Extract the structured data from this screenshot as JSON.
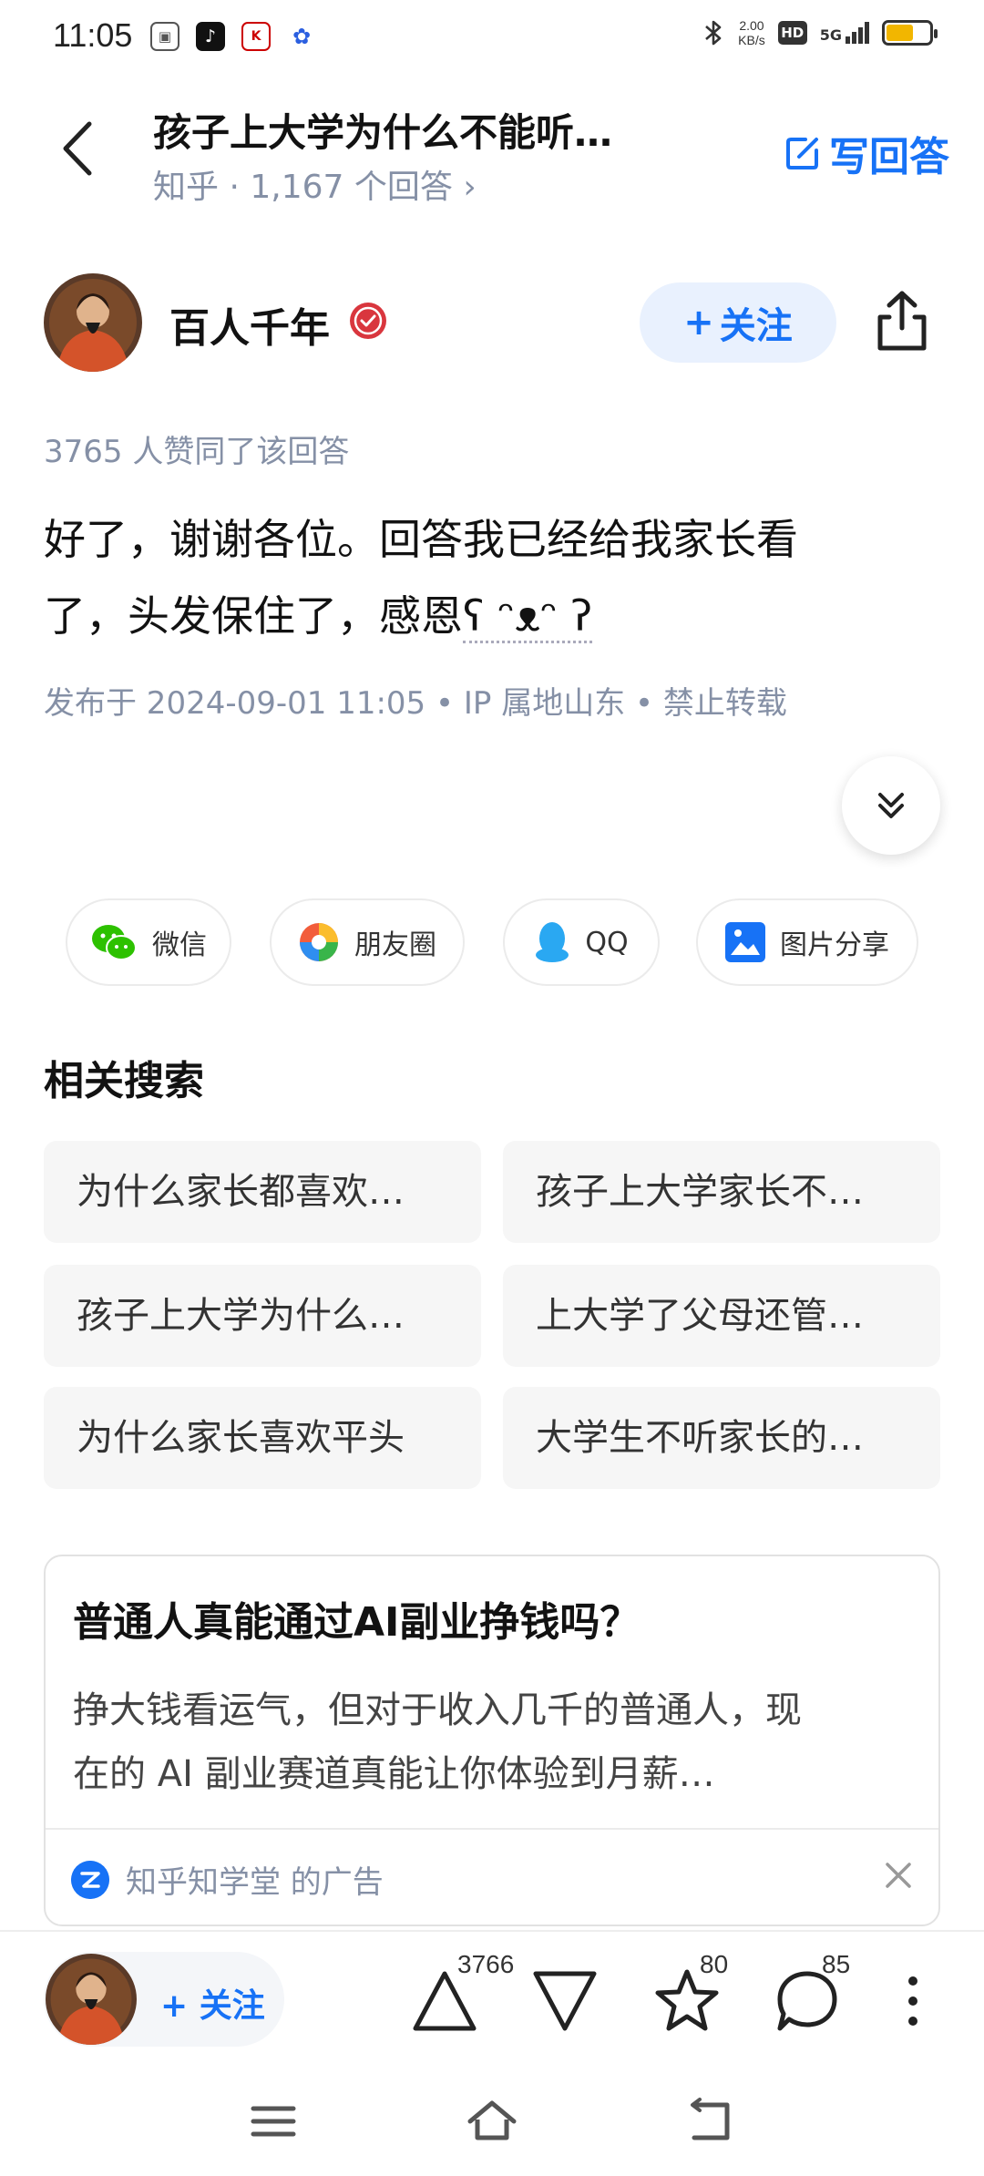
{
  "status_bar": {
    "time": "11:05",
    "net_speed_value": "2.00",
    "net_speed_unit": "KB/s",
    "hd": "HD",
    "signal": "5G"
  },
  "header": {
    "question_title": "孩子上大学为什么不能听…",
    "source": "知乎",
    "answer_count": "1,167 个回答",
    "write_answer": "写回答"
  },
  "author": {
    "name": "百人千年",
    "follow_label": "关注"
  },
  "answer": {
    "agree_text": "3765 人赞同了该回答",
    "line1": "好了，谢谢各位。回答我已经给我家长看",
    "line2_text": "了，头发保住了，感恩",
    "line2_kaomoji": "ʕ ᵔᴥᵔ ʔ",
    "publish_date": "发布于 2024-09-01 11:05",
    "ip": "IP 属地山东",
    "copyright": "禁止转载"
  },
  "share": {
    "items": [
      {
        "label": "微信"
      },
      {
        "label": "朋友圈"
      },
      {
        "label": "QQ"
      },
      {
        "label": "图片分享"
      }
    ]
  },
  "related": {
    "title": "相关搜索",
    "items": [
      {
        "label": "为什么家长都喜欢…"
      },
      {
        "label": "孩子上大学家长不…"
      },
      {
        "label": "孩子上大学为什么…"
      },
      {
        "label": "上大学了父母还管…"
      },
      {
        "label": "为什么家长喜欢平头"
      },
      {
        "label": "大学生不听家长的…"
      }
    ]
  },
  "ad": {
    "title": "普通人真能通过AI副业挣钱吗？",
    "desc_line1": "挣大钱看运气，但对于收入几千的普通人，现",
    "desc_line2": "在的 AI 副业赛道真能让你体验到月薪…",
    "source": "知乎知学堂 的广告"
  },
  "bottom_bar": {
    "follow_label": "关注",
    "upvote_count": "3766",
    "favorite_count": "80",
    "comment_count": "85"
  },
  "colors": {
    "accent": "#1772f6",
    "meta_gray": "#8590a6",
    "battery": "#f2b600"
  }
}
